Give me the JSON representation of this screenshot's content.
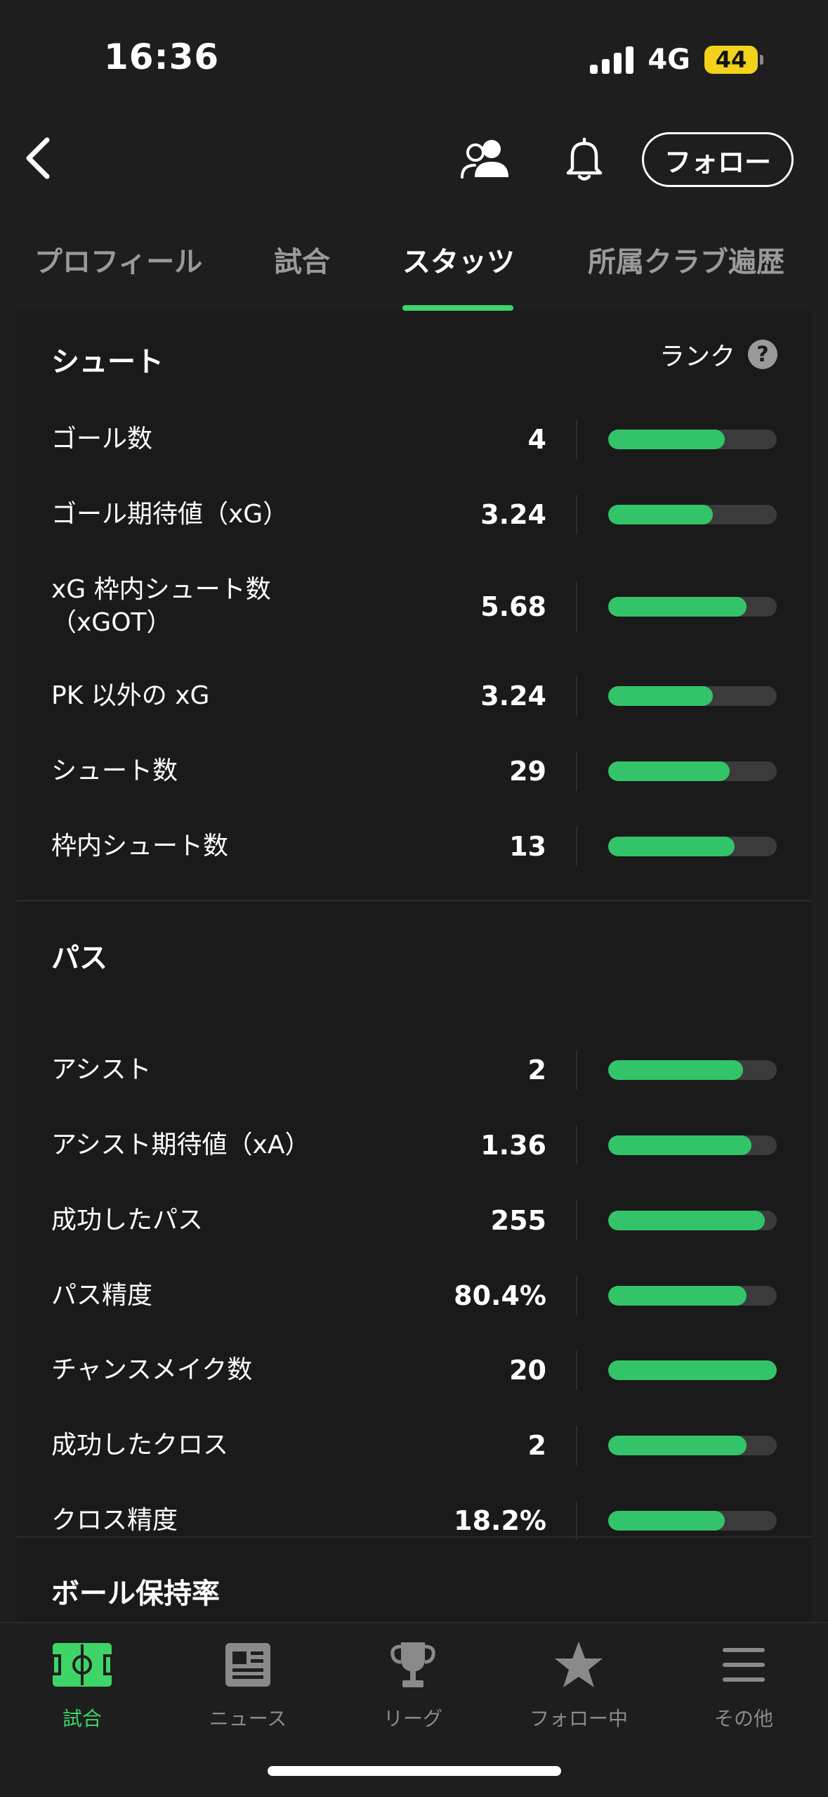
{
  "status": {
    "time": "16:36",
    "network": "4G",
    "battery": "44"
  },
  "header": {
    "follow_label": "フォロー"
  },
  "tabs": [
    {
      "label": "プロフィール"
    },
    {
      "label": "試合"
    },
    {
      "label": "スタッツ"
    },
    {
      "label": "所属クラブ遍歴"
    }
  ],
  "active_tab": "スタッツ",
  "colors": {
    "accent": "#3fd467",
    "bar": "#33c46a",
    "track": "#3b3b3b",
    "background": "#1e1e1e"
  },
  "sections": {
    "shoot": {
      "title": "シュート",
      "rank_label": "ランク",
      "rank_help": "?",
      "rows": [
        {
          "label": "ゴール数",
          "value": "4",
          "rank_fraction": 0.69
        },
        {
          "label": "ゴール期待値（xG）",
          "value": "3.24",
          "rank_fraction": 0.62
        },
        {
          "label": "xG 枠内シュート数\n（xGOT）",
          "value": "5.68",
          "rank_fraction": 0.82
        },
        {
          "label": "PK 以外の xG",
          "value": "3.24",
          "rank_fraction": 0.62
        },
        {
          "label": "シュート数",
          "value": "29",
          "rank_fraction": 0.72
        },
        {
          "label": "枠内シュート数",
          "value": "13",
          "rank_fraction": 0.75
        }
      ]
    },
    "pass": {
      "title": "パス",
      "rows": [
        {
          "label": "アシスト",
          "value": "2",
          "rank_fraction": 0.8
        },
        {
          "label": "アシスト期待値（xA）",
          "value": "1.36",
          "rank_fraction": 0.85
        },
        {
          "label": "成功したパス",
          "value": "255",
          "rank_fraction": 0.93
        },
        {
          "label": "パス精度",
          "value": "80.4%",
          "rank_fraction": 0.82
        },
        {
          "label": "チャンスメイク数",
          "value": "20",
          "rank_fraction": 1.0
        },
        {
          "label": "成功したクロス",
          "value": "2",
          "rank_fraction": 0.82
        },
        {
          "label": "クロス精度",
          "value": "18.2%",
          "rank_fraction": 0.69
        }
      ]
    },
    "possession": {
      "title": "ボール保持率"
    }
  },
  "bottom_nav": [
    {
      "label": "試合",
      "icon": "pitch-icon",
      "active": true
    },
    {
      "label": "ニュース",
      "icon": "newspaper-icon",
      "active": false
    },
    {
      "label": "リーグ",
      "icon": "trophy-icon",
      "active": false
    },
    {
      "label": "フォロー中",
      "icon": "star-icon",
      "active": false
    },
    {
      "label": "その他",
      "icon": "menu-icon",
      "active": false
    }
  ]
}
